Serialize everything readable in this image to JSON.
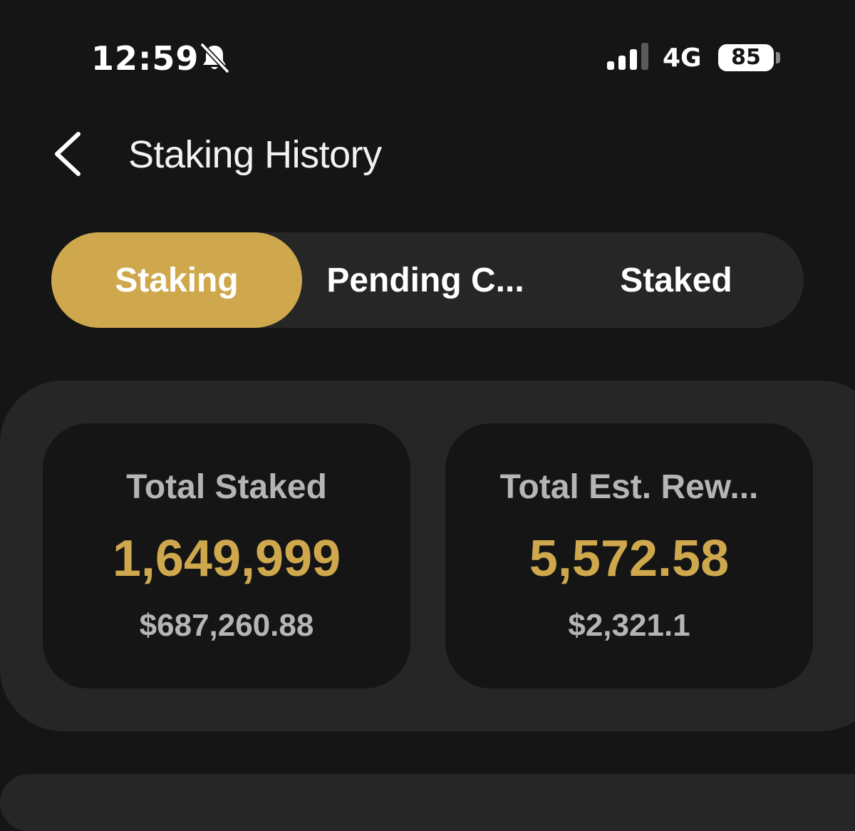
{
  "status_bar": {
    "time": "12:59",
    "network": "4G",
    "battery_level": "85",
    "icons": {
      "silent": "bell-slash-icon",
      "signal": "cellular-signal-icon",
      "battery": "battery-icon"
    }
  },
  "header": {
    "back_icon": "chevron-left-icon",
    "title": "Staking History"
  },
  "tabs": [
    {
      "label": "Staking",
      "active": true
    },
    {
      "label": "Pending C...",
      "active": false
    },
    {
      "label": "Staked",
      "active": false
    }
  ],
  "summary": {
    "total_staked": {
      "label": "Total Staked",
      "value": "1,649,999",
      "usd": "$687,260.88"
    },
    "total_rewards": {
      "label": "Total Est. Rew...",
      "value": "5,572.58",
      "usd": "$2,321.1"
    }
  },
  "colors": {
    "accent": "#cfa84d",
    "background": "#151515",
    "surface": "#262626",
    "muted_text": "#b5b5b5"
  }
}
